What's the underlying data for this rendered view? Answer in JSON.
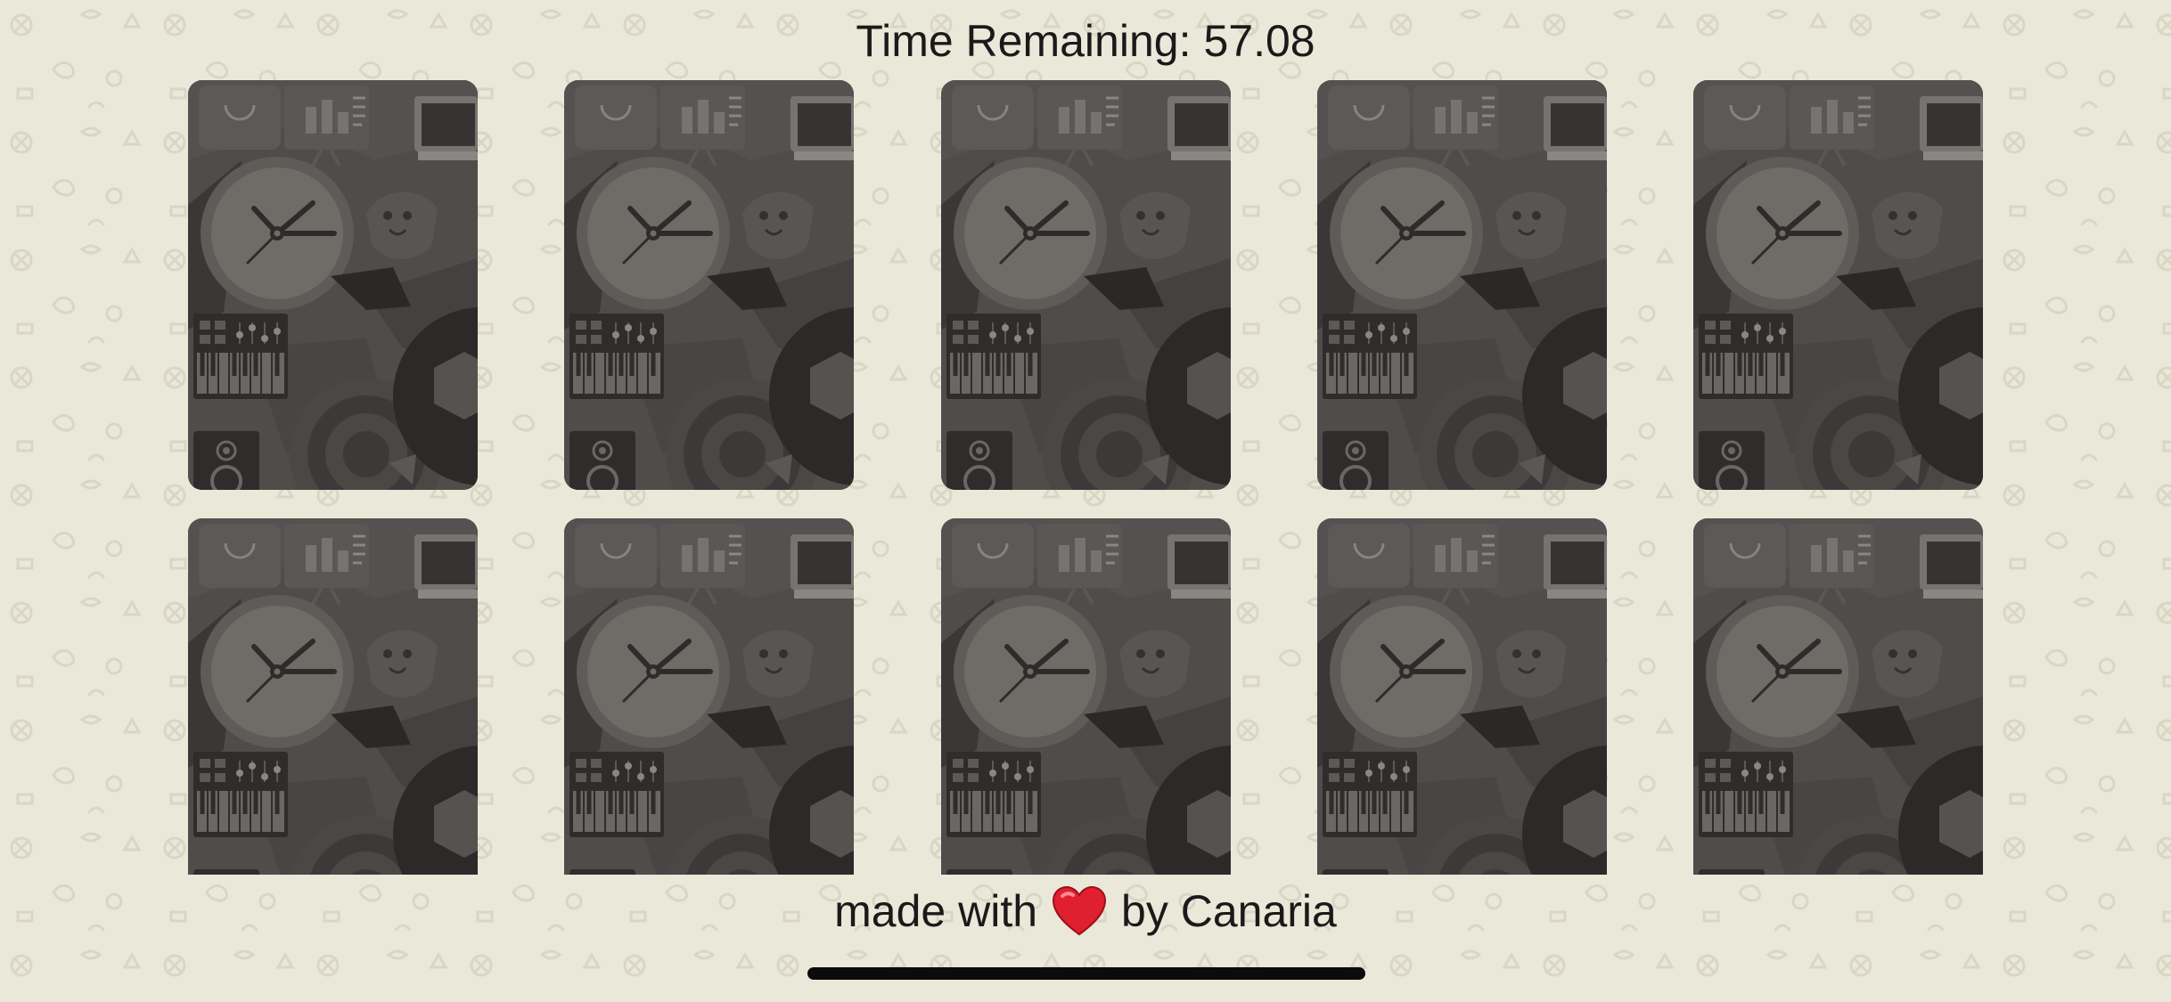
{
  "game": {
    "timer_label": "Time Remaining:",
    "timer_value": "57.08",
    "cards": [
      {
        "state": "face-down"
      },
      {
        "state": "face-down"
      },
      {
        "state": "face-down"
      },
      {
        "state": "face-down"
      },
      {
        "state": "face-down"
      },
      {
        "state": "face-down"
      },
      {
        "state": "face-down"
      },
      {
        "state": "face-down"
      },
      {
        "state": "face-down"
      },
      {
        "state": "face-down"
      }
    ],
    "card_back_icons": [
      "shopping-bag-icon",
      "presentation-board-icon",
      "monitor-icon",
      "clock-icon",
      "face-icon",
      "synthesizer-keyboard-icon",
      "speaker-icon",
      "target-icon",
      "hexagon-icon"
    ]
  },
  "footer": {
    "text_before": "made with",
    "heart_icon": "heart-icon",
    "text_after": "by Canaria"
  },
  "colors": {
    "background": "#eae8d9",
    "card_back": "#4f4c4a",
    "heart": "#e0202f",
    "text": "#1a1a1a"
  }
}
